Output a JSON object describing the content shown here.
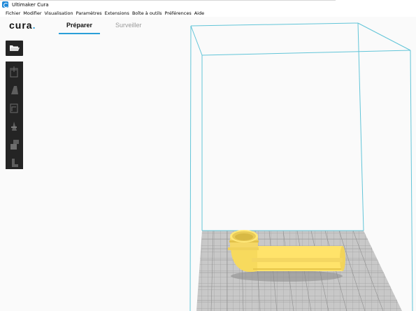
{
  "window": {
    "title": "Ultimaker Cura"
  },
  "menu": [
    "Fichier",
    "Modifier",
    "Visualisation",
    "Paramètres",
    "Extensions",
    "Boîte à outils",
    "Préférences",
    "Aide"
  ],
  "brand": {
    "name": "cura",
    "dot": "."
  },
  "tabs": [
    {
      "label": "Préparer",
      "active": true
    },
    {
      "label": "Surveiller",
      "active": false
    }
  ],
  "toolbar": {
    "open_icon": "folder-icon",
    "tools": [
      "move-icon",
      "scale-icon",
      "rotate-icon",
      "mirror-icon",
      "per-model-settings-icon",
      "support-blocker-icon"
    ]
  },
  "colors": {
    "build_volume": "#62c5d8",
    "model": "#ffe36a",
    "model_shade": "#e8c84a",
    "toolbar": "#242424",
    "accent": "#2a9fd8"
  }
}
